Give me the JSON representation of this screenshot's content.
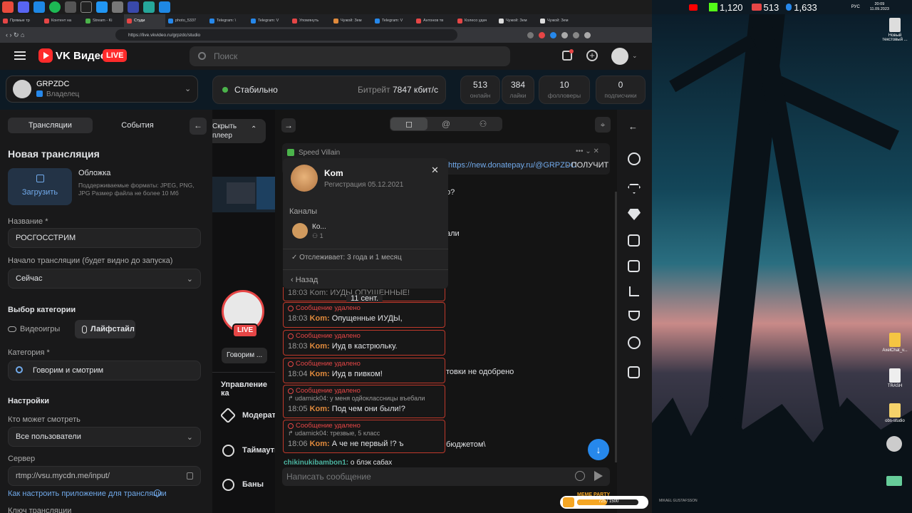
{
  "taskbar": {
    "right_counts": [
      "1,120",
      "513",
      "1,633"
    ],
    "clock": "20:09",
    "date": "11.09.2023",
    "lang": "РУС"
  },
  "browser": {
    "tabs": [
      "Прямые тр",
      "Контент на",
      "Stream - Ki",
      "Студи",
      "photo_5337",
      "Telegram: \\",
      "Telegram: V",
      "Упомянуть",
      "Чужой: Зем",
      "Telegram: V",
      "Антонов тв",
      "Колесо удач",
      "Чужой: Зем",
      "Чужой: Зем"
    ],
    "url": "https://live.vkvideo.ru/grpzdc/studio"
  },
  "header": {
    "logo": "VK Видео",
    "live_badge": "LIVE",
    "search_placeholder": "Поиск"
  },
  "channel": {
    "name": "GRPZDC",
    "role": "Владелец"
  },
  "status": {
    "state": "Стабильно",
    "bitrate_label": "Битрейт",
    "bitrate_value": "7847 кбит/с"
  },
  "stats": [
    {
      "n": "513",
      "l": "онлайн"
    },
    {
      "n": "384",
      "l": "лайки"
    },
    {
      "n": "10",
      "l": "фолловеры"
    },
    {
      "n": "0",
      "l": "подписчики"
    }
  ],
  "left": {
    "tab_streams": "Трансляции",
    "tab_events": "События",
    "title": "Новая трансляция",
    "cover_label": "Обложка",
    "upload": "Загрузить",
    "cover_hint": "Поддерживаемые форматы: JPEG, PNG, JPG Размер файла не более 10 Мб",
    "name_label": "Название *",
    "name_value": "РОСГОССТРИМ",
    "start_label": "Начало трансляции (будет видно до запуска)",
    "start_value": "Сейчас",
    "category_header": "Выбор категории",
    "cat_games": "Видеоигры",
    "cat_life": "Лайфстайл",
    "category_label": "Категория *",
    "category_value": "Говорим и смотрим",
    "settings_header": "Настройки",
    "who_label": "Кто может смотреть",
    "who_value": "Все пользователи",
    "server_label": "Сервер",
    "server_value": "rtmp://vsu.mycdn.me/input/",
    "howto": "Как настроить приложение для трансляции",
    "key_label": "Ключ трансляции"
  },
  "mid": {
    "hide_player": "Скрыть плеер",
    "live": "LIVE",
    "tag": "Говорим ...",
    "manage": "Управление ка",
    "moderators": "Модерато",
    "timeouts": "Таймауты",
    "bans": "Баны"
  },
  "chat": {
    "pinned_user": "Speed Villain",
    "pinned_link": "https://new.donatepay.ru/@GRPZDC",
    "pinned_tail": " - ПОЛУЧИТ",
    "bg_lines": [
      "о?",
      "али",
      "товки не одобрено",
      "бюджетом\\"
    ],
    "date_sep": "11 сент.",
    "top_cut": "18:03 Kom: ИУДЫ ОПУЩЕННЫЕ!",
    "deleted_label": "Сообщение удалено",
    "messages": [
      {
        "time": "18:03",
        "nick": "Kom:",
        "text": "Опущенные ИУДЫ,",
        "reply": ""
      },
      {
        "time": "18:03",
        "nick": "Kom:",
        "text": "Иуд в кастрюльку.",
        "reply": ""
      },
      {
        "time": "18:04",
        "nick": "Kom:",
        "text": "Иуд в пивком!",
        "reply": ""
      },
      {
        "time": "18:05",
        "nick": "Kom:",
        "text": "Под чем они были!?",
        "reply": "udarnick04: у меня одйоклассницы въебали"
      },
      {
        "time": "18:06",
        "nick": "Kom:",
        "text": "А че не первый !? ъ",
        "reply": "udarnick04: трезвые, 5 класс"
      }
    ],
    "bottom_user": "chikinukibambon1:",
    "bottom_text": " о блэк сабах",
    "input_placeholder": "Написать сообщение"
  },
  "popup": {
    "name": "Kom",
    "reg": "Регистрация 05.12.2021",
    "channels_label": "Каналы",
    "channel_name": "Ко...",
    "channel_count": "1",
    "follows": "Отслеживает: 3 года и 1 месяц",
    "back": "Назад"
  },
  "desktop": {
    "icons": [
      "Новый текстовый ...",
      "AxelChat_v...",
      "TRASH",
      "obs-studio"
    ],
    "watermark": "MIKAEL GUSTAFSSON",
    "meme_label": "MEME PARTY",
    "meme_progress": "725 / 1500"
  },
  "colors": {
    "accent": "#2688eb",
    "live": "#e64646",
    "nick": "#e08a3c",
    "deleted": "#e64646",
    "online": "#4bb34b"
  }
}
